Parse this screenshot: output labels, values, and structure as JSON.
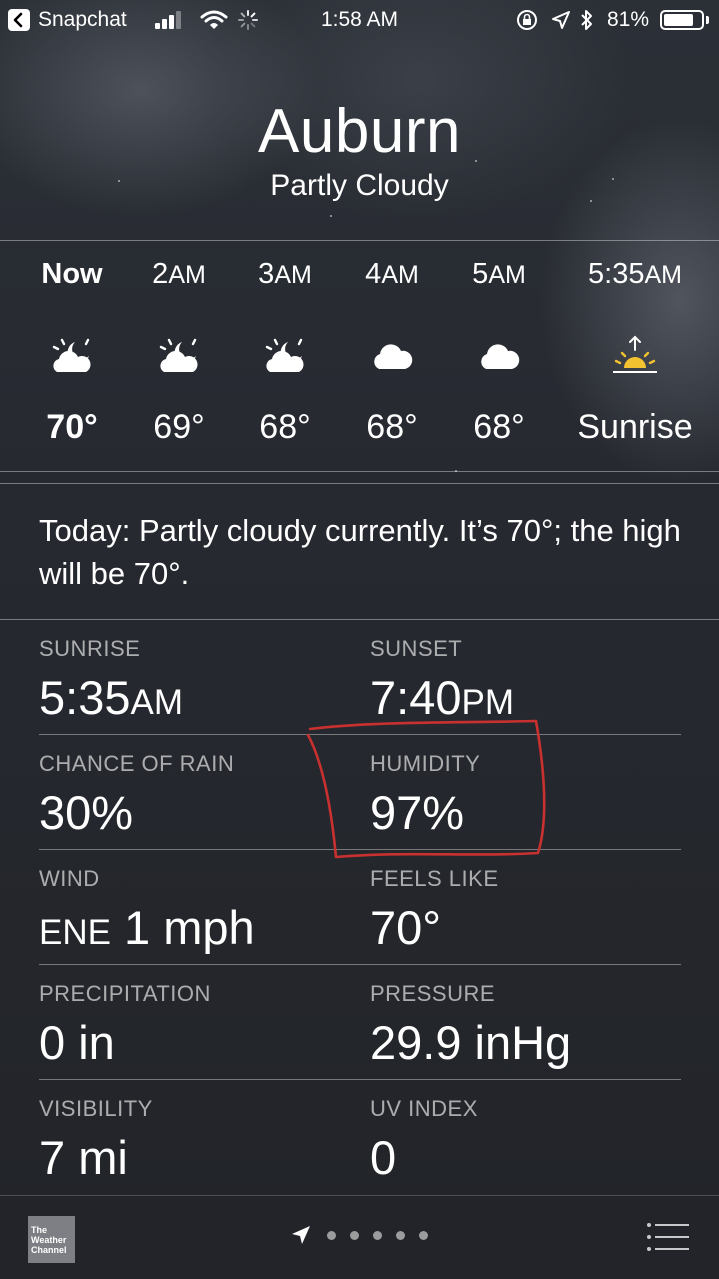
{
  "status_bar": {
    "back_app": "Snapchat",
    "time": "1:58 AM",
    "battery_percent": "81%",
    "battery_level": 0.81
  },
  "header": {
    "city": "Auburn",
    "condition": "Partly Cloudy"
  },
  "hourly": [
    {
      "time_num": "Now",
      "time_suffix": "",
      "icon": "partly-cloudy-night-icon",
      "temp": "70°",
      "is_now": true
    },
    {
      "time_num": "2",
      "time_suffix": "AM",
      "icon": "partly-cloudy-night-icon",
      "temp": "69°"
    },
    {
      "time_num": "3",
      "time_suffix": "AM",
      "icon": "partly-cloudy-night-icon",
      "temp": "68°"
    },
    {
      "time_num": "4",
      "time_suffix": "AM",
      "icon": "cloud-icon",
      "temp": "68°"
    },
    {
      "time_num": "5",
      "time_suffix": "AM",
      "icon": "cloud-icon",
      "temp": "68°"
    },
    {
      "time_num": "5:35",
      "time_suffix": "AM",
      "icon": "sunrise-icon",
      "temp": "Sunrise"
    }
  ],
  "summary": "Today: Partly cloudy currently. It’s 70°; the high will be 70°.",
  "details": {
    "sunrise": {
      "label": "SUNRISE",
      "value": "5:35",
      "suffix": "AM"
    },
    "sunset": {
      "label": "SUNSET",
      "value": "7:40",
      "suffix": "PM"
    },
    "chance_of_rain": {
      "label": "CHANCE OF RAIN",
      "value": "30%"
    },
    "humidity": {
      "label": "HUMIDITY",
      "value": "97%"
    },
    "wind": {
      "label": "WIND",
      "dir": "ENE",
      "value": "1 mph"
    },
    "feels_like": {
      "label": "FEELS LIKE",
      "value": "70°"
    },
    "precipitation": {
      "label": "PRECIPITATION",
      "value": "0 in"
    },
    "pressure": {
      "label": "PRESSURE",
      "value": "29.9 inHg"
    },
    "visibility": {
      "label": "VISIBILITY",
      "value": "7 mi"
    },
    "uv_index": {
      "label": "UV INDEX",
      "value": "0"
    }
  },
  "bottom_bar": {
    "logo_line1": "The",
    "logo_line2": "Weather",
    "logo_line3": "Channel",
    "page_count": 5
  },
  "colors": {
    "annotation": "#c8312f",
    "sun": "#f2c230"
  }
}
